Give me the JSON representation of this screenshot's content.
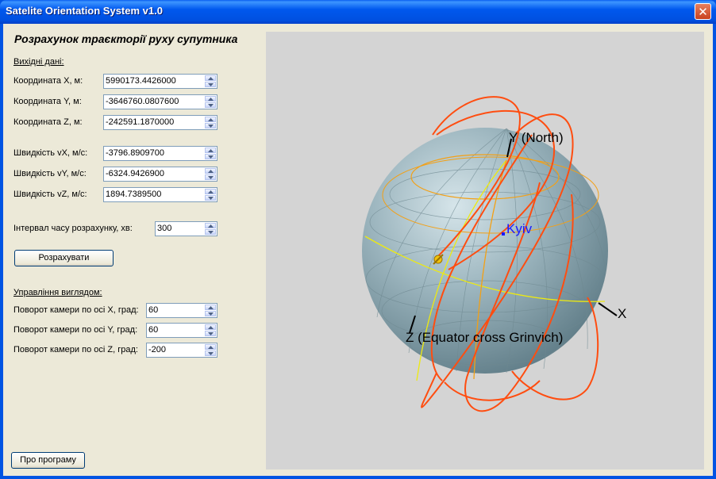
{
  "window": {
    "title": "Satelite Orientation System v1.0",
    "close_glyph": "✕"
  },
  "heading": "Розрахунок траєкторії руху супутника",
  "input_section": "Вихідні дані:",
  "coords": [
    {
      "label": "Координата X, м:",
      "value": "5990173.4426000"
    },
    {
      "label": "Координата Y, м:",
      "value": "-3646760.0807600"
    },
    {
      "label": "Координата Z, м:",
      "value": "-242591.1870000"
    }
  ],
  "velocities": [
    {
      "label": "Швидкість vX, м/с:",
      "value": "-3796.8909700"
    },
    {
      "label": "Швидкість vY, м/с:",
      "value": "-6324.9426900"
    },
    {
      "label": "Швидкість vZ, м/с:",
      "value": "1894.7389500"
    }
  ],
  "interval": {
    "label": "Інтервал часу розрахунку, хв:",
    "value": "300"
  },
  "calc_button": "Розрахувати",
  "view_section": "Управління виглядом:",
  "camera": [
    {
      "label": "Поворот камери по осі X, град:",
      "value": "60"
    },
    {
      "label": "Поворот камери по осі Y, град:",
      "value": "60"
    },
    {
      "label": "Поворот камери по осі Z, град:",
      "value": "-200"
    }
  ],
  "about_button": "Про програму",
  "scene": {
    "axis_y_label": "Y (North)",
    "axis_x_label": "X",
    "axis_z_label": "Z (Equator cross Grinvich)",
    "city_label": "Kyiv",
    "colors": {
      "globe": "#8fa9b3",
      "orbit": "#ff4d10",
      "equator": "#f5f000",
      "latitude": "#ff9a10",
      "city": "#1a1aff"
    }
  }
}
